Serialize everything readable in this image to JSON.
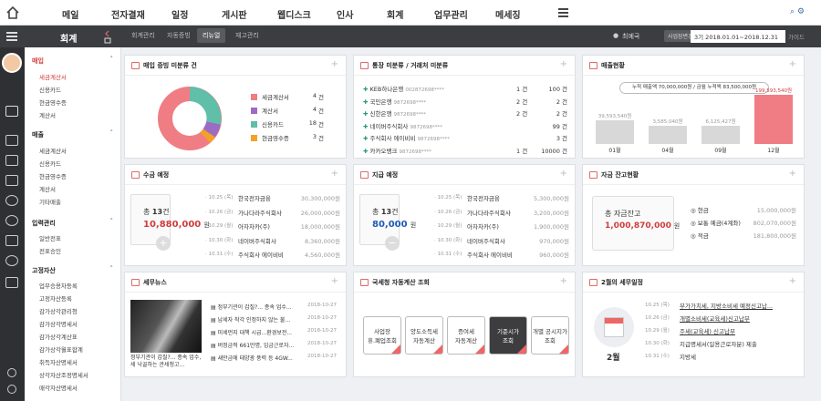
{
  "nav": {
    "items": [
      "메일",
      "전자결재",
      "일정",
      "게시판",
      "웹디스크",
      "인사",
      "회계",
      "업무관리",
      "메세징"
    ]
  },
  "app": {
    "title": "회계",
    "tabs": [
      "회계관리",
      "자동증빙",
      "리뉴얼",
      "재고관리"
    ],
    "user": "최예국",
    "biz_btn": "사업장변경",
    "period": "3기 2018.01.01~2018.12.31",
    "guide": "가이드"
  },
  "side": {
    "groups": [
      {
        "title": "매입",
        "items": [
          "세금계산서",
          "신용카드",
          "현금영수증",
          "계산서"
        ]
      },
      {
        "title": "매출",
        "items": [
          "세금계산서",
          "신용카드",
          "현금영수증",
          "계산서",
          "기타매출"
        ]
      },
      {
        "title": "입력관리",
        "items": [
          "일반전표",
          "전표승인"
        ]
      },
      {
        "title": "고정자산",
        "items": [
          "업무승용차등록",
          "고정자산등록",
          "감가상각관리청",
          "감가상각명세서",
          "감가상각계산표",
          "감가상각월표합계",
          "취득자산명세서",
          "상각자산조정명세서",
          "매각자산명세서"
        ]
      }
    ]
  },
  "cards": {
    "purchase": {
      "title": "매입 증빙 미분류 건",
      "legend": [
        {
          "label": "세금계산서",
          "count": "4",
          "unit": "건"
        },
        {
          "label": "계산서",
          "count": "4",
          "unit": "건"
        },
        {
          "label": "신용카드",
          "count": "18",
          "unit": "건"
        },
        {
          "label": "현금영수증",
          "count": "3",
          "unit": "건"
        }
      ]
    },
    "bank": {
      "title": "통장 미분류 / 거래처 미분류",
      "rows": [
        {
          "name": "KEB하나은행",
          "acct": "002872698****",
          "a": "1",
          "au": "건",
          "b": "100",
          "bu": "건"
        },
        {
          "name": "국민은행",
          "acct": "9872698****",
          "a": "2",
          "au": "건",
          "b": "2",
          "bu": "건"
        },
        {
          "name": "신한은행",
          "acct": "9872698****",
          "a": "2",
          "au": "건",
          "b": "2",
          "bu": "건"
        },
        {
          "name": "네이버주식회사",
          "acct": "9872698****",
          "a": "",
          "au": "",
          "b": "99",
          "bu": "건"
        },
        {
          "name": "주식회사 에이비비",
          "acct": "9872698****",
          "a": "",
          "au": "",
          "b": "3",
          "bu": "건"
        },
        {
          "name": "카카오뱅크",
          "acct": "9872698****",
          "a": "1",
          "au": "건",
          "b": "10000",
          "bu": "건"
        }
      ]
    },
    "sales": {
      "title": "매출현황",
      "summary": "누적 매출액 70,000,000원 / 금월 누적액 83,500,000원",
      "bars": [
        {
          "label": "01월",
          "value": "39,593,540원",
          "v": 39593540
        },
        {
          "label": "04월",
          "value": "3,585,040원",
          "v": 3585040
        },
        {
          "label": "09월",
          "value": "6,125,427원",
          "v": 6125427
        },
        {
          "label": "12월",
          "value": "199,593,540원",
          "v": 199593540
        }
      ]
    },
    "receive": {
      "title": "수금 예정",
      "count_label": "총",
      "count": "13",
      "count_unit": "건",
      "amount": "10,880,000",
      "amount_unit": "원",
      "rows": [
        {
          "date": "10.25 (목)",
          "name": "한국전자금융",
          "amt": "30,300,000원"
        },
        {
          "date": "10.26 (금)",
          "name": "가나다라주식회사",
          "amt": "26,000,000원"
        },
        {
          "date": "10.29 (월)",
          "name": "아자차카(주)",
          "amt": "18,000,000원"
        },
        {
          "date": "10.30 (화)",
          "name": "네이버주식회사",
          "amt": "8,360,000원"
        },
        {
          "date": "10.31 (수)",
          "name": "주식회사 에이비비",
          "amt": "4,560,000원"
        }
      ]
    },
    "payment": {
      "title": "지급 예정",
      "count_label": "총",
      "count": "13",
      "count_unit": "건",
      "amount": "80,000",
      "amount_unit": "원",
      "rows": [
        {
          "date": "10.25 (목)",
          "name": "한국전자금융",
          "amt": "5,300,000원"
        },
        {
          "date": "10.26 (금)",
          "name": "가나다라주식회사",
          "amt": "3,200,000원"
        },
        {
          "date": "10.29 (월)",
          "name": "아자차카(주)",
          "amt": "1,900,000원"
        },
        {
          "date": "10.30 (화)",
          "name": "네이버주식회사",
          "amt": "970,000원"
        },
        {
          "date": "10.31 (수)",
          "name": "주식회사 에이비비",
          "amt": "960,000원"
        }
      ]
    },
    "balance": {
      "title": "자금 잔고현황",
      "label": "총 자금잔고",
      "amount": "1,000,870,000",
      "unit": "원",
      "rows": [
        {
          "name": "현금",
          "amt": "15,000,000원"
        },
        {
          "name": "보통 예금(4계좌)",
          "amt": "802,070,000원"
        },
        {
          "name": "적금",
          "amt": "181,800,000원"
        }
      ]
    },
    "news": {
      "title": "세무뉴스",
      "caption": "정부기관이 갑질?... 종속 업수, 세 낙골하는 관세청고…",
      "rows": [
        {
          "t": "정부기관이 갑질?... 종속 업수...",
          "d": "2018-10-27"
        },
        {
          "t": "납세자 착각 인정하지 않는 불...",
          "d": "2018-10-27"
        },
        {
          "t": "미세먼지 대책 시급...환경보전...",
          "d": "2018-10-27"
        },
        {
          "t": "버정금적 661만명, 임금근로자...",
          "d": "2018-10-27"
        },
        {
          "t": "새만금에 태양광 풍력 등 4GW...",
          "d": "2018-10-27"
        }
      ]
    },
    "auto": {
      "title": "국세청 자동계산 조회",
      "boxes": [
        "사업장\n휴.폐업조회",
        "양도소득세\n자동계산",
        "증여세\n자동계산",
        "기준시가\n조회",
        "개별 공시지가\n조회"
      ]
    },
    "schedule": {
      "title": "2월의 세무일정",
      "month": "2월",
      "rows": [
        {
          "d": "10.25 (목)",
          "t": "부가가치세, 지방소비세 예정신고납..."
        },
        {
          "d": "10.26 (금)",
          "t": "개별소비세(교육세)신고납부"
        },
        {
          "d": "10.29 (월)",
          "t": "주세(교육세) 신고납부"
        },
        {
          "d": "10.30 (화)",
          "t": "지급명세서(일용근로자분) 제출"
        },
        {
          "d": "10.31 (수)",
          "t": "지방세"
        }
      ]
    }
  }
}
